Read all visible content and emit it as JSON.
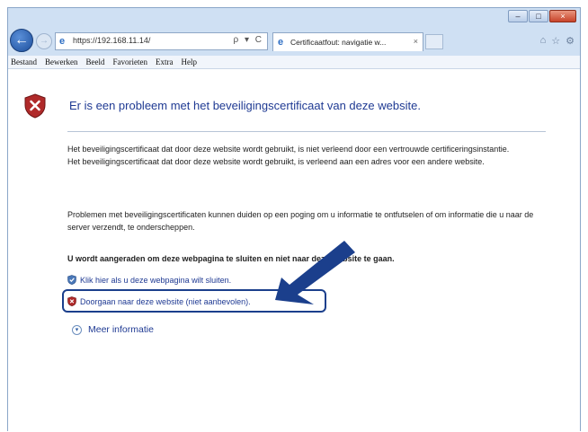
{
  "browser": {
    "address_url": "https://192.168.11.14/",
    "address_tools": "ρ ▾ C",
    "tab_title": "Certificaatfout: navigatie w...",
    "tab_close": "×",
    "caption_minimize": "–",
    "caption_maximize": "□",
    "caption_close": "×",
    "tool_icons": [
      "home-icon",
      "star-icon",
      "gear-icon"
    ]
  },
  "menu": {
    "items": [
      "Bestand",
      "Bewerken",
      "Beeld",
      "Favorieten",
      "Extra",
      "Help"
    ]
  },
  "page": {
    "title": "Er is een probleem met het beveiligingscertificaat van deze website.",
    "paragraph1_line1": "Het beveiligingscertificaat dat door deze website wordt gebruikt, is niet verleend door een vertrouwde certificeringsinstantie.",
    "paragraph1_line2": "Het beveiligingscertificaat dat door deze website wordt gebruikt, is verleend aan een adres voor een andere website.",
    "paragraph2": "Problemen met beveiligingscertificaten kunnen duiden op een poging om u informatie te ontfutselen of om informatie die u naar de server verzendt, te onderscheppen.",
    "recommendation": "U wordt aangeraden om deze webpagina te sluiten en niet naar deze website te gaan.",
    "close_link": "Klik hier als u deze webpagina wilt sluiten.",
    "continue_link": "Doorgaan naar deze website (niet aanbevolen).",
    "more_info": "Meer informatie"
  },
  "colors": {
    "link": "#1f3a93",
    "accent_annotation": "#1b3f8c",
    "shield_red": "#a02020"
  }
}
